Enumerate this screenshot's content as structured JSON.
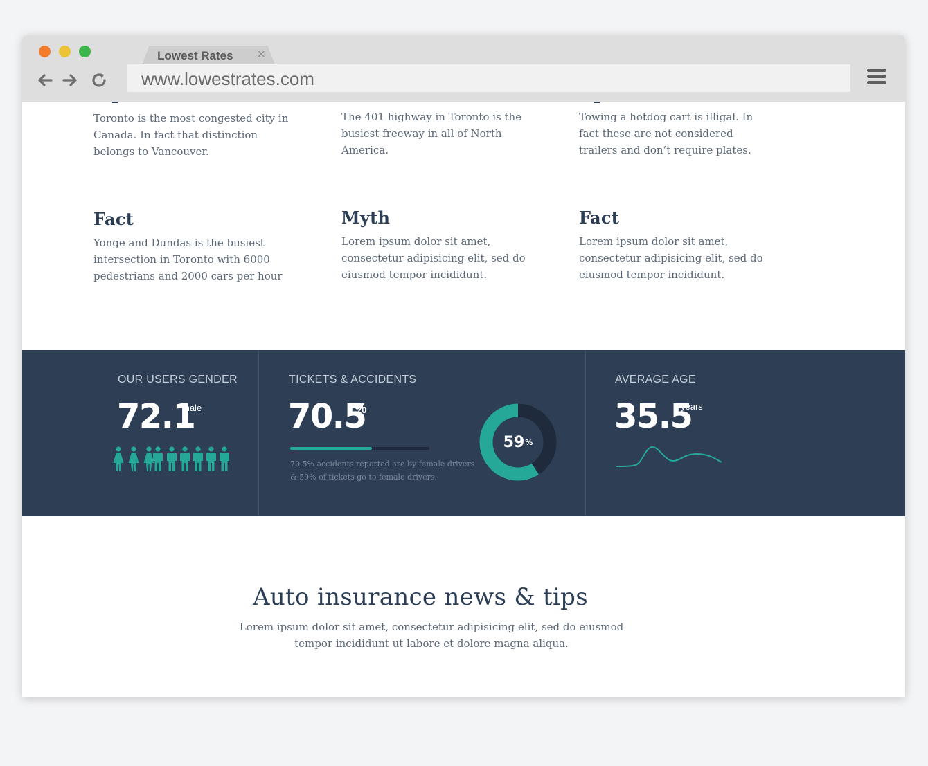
{
  "browser": {
    "tab_title": "Lowest Rates",
    "tab_close": "×",
    "url": "www.lowestrates.com",
    "icons": {
      "back": "arrow-left-icon",
      "forward": "arrow-right-icon",
      "reload": "reload-icon",
      "menu": "hamburger-menu-icon",
      "close": "close-icon"
    },
    "traffic_lights": [
      "#f47b2a",
      "#eac435",
      "#3cb54a"
    ]
  },
  "facts": {
    "row1": [
      {
        "text": "Toronto is the most congested city in Canada. In fact that distinction belongs to Vancouver."
      },
      {
        "text": "The 401 highway in Toronto is the busiest freeway in all of North America."
      },
      {
        "text": "Towing a hotdog cart is illigal. In fact these are not considered trailers and don’t require plates."
      }
    ],
    "row2": [
      {
        "title": "Fact",
        "text": "Yonge and Dundas is the busiest intersection in Toronto with 6000 pedestrians and 2000 cars per hour"
      },
      {
        "title": "Myth",
        "text": "Lorem ipsum dolor sit amet, consectetur adipisicing elit, sed do eiusmod tempor incididunt."
      },
      {
        "title": "Fact",
        "text": "Lorem ipsum dolor sit amet, consectetur adipisicing elit, sed do eiusmod tempor incididunt."
      }
    ]
  },
  "stats": {
    "gender": {
      "label": "OUR USERS GENDER",
      "value": "72.1",
      "unit": "male",
      "people": [
        "female",
        "female",
        "female",
        "male",
        "male",
        "male",
        "male",
        "male",
        "male"
      ]
    },
    "tickets": {
      "label": "TICKETS & ACCIDENTS",
      "value": "70.5",
      "unit": "%",
      "progress": 0.585,
      "note": "70.5% accidents reported are by female drivers & 59% of tickets go to female drivers.",
      "donut_value": "59",
      "donut_unit": "%",
      "donut_fraction": 0.59
    },
    "age": {
      "label": "AVERAGE AGE",
      "value": "35.5",
      "unit": "years"
    },
    "colors": {
      "accent": "#25a898",
      "band": "#2d3e55",
      "track": "#1f2b3c"
    }
  },
  "news": {
    "title": "Auto insurance news & tips",
    "text": "Lorem ipsum dolor sit amet, consectetur adipisicing elit, sed do eiusmod tempor incididunt ut labore et dolore magna aliqua."
  }
}
